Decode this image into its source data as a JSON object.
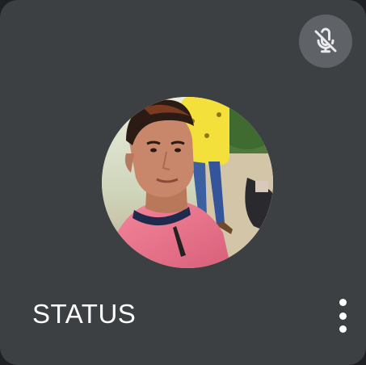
{
  "participant": {
    "name": "STATUS",
    "mic_state_icon": "mic-off-icon",
    "menu_icon": "more-vert-icon"
  },
  "colors": {
    "tile_background": "#3c4043",
    "badge_background": "#5f6368",
    "text": "#ffffff"
  }
}
